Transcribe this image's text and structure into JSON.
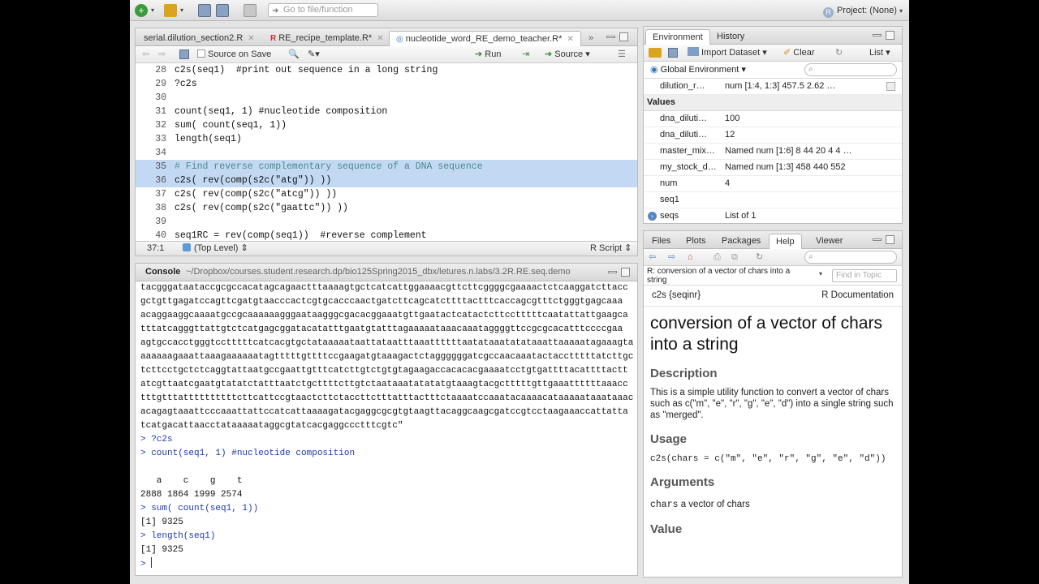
{
  "toolbar": {
    "goto_placeholder": "Go to file/function",
    "project_label": "Project: (None)"
  },
  "editor": {
    "tabs": [
      {
        "label": "serial.dilution_section2.R",
        "modified": false
      },
      {
        "label": "RE_recipe_template.R*",
        "modified": true
      },
      {
        "label": "nucleotide_word_RE_demo_teacher.R*",
        "modified": true
      }
    ],
    "source_on_save": "Source on Save",
    "run_label": "Run",
    "source_label": "Source",
    "cursor_pos": "37:1",
    "scope": "(Top Level)",
    "file_type": "R Script",
    "lines": [
      {
        "n": "28",
        "code": "c2s(seq1)  #print out sequence in a long string"
      },
      {
        "n": "29",
        "code": "?c2s"
      },
      {
        "n": "30",
        "code": ""
      },
      {
        "n": "31",
        "code": "count(seq1, 1) #nucleotide composition"
      },
      {
        "n": "32",
        "code": "sum( count(seq1, 1))"
      },
      {
        "n": "33",
        "code": "length(seq1)"
      },
      {
        "n": "34",
        "code": ""
      },
      {
        "n": "35",
        "code": "# Find reverse complementary sequence of a DNA sequence"
      },
      {
        "n": "36",
        "code": "c2s( rev(comp(s2c(\"atg\")) ))"
      },
      {
        "n": "37",
        "code": "c2s( rev(comp(s2c(\"atcg\")) ))"
      },
      {
        "n": "38",
        "code": "c2s( rev(comp(s2c(\"gaattc\")) ))"
      },
      {
        "n": "39",
        "code": ""
      },
      {
        "n": "40",
        "code": "seq1RC = rev(comp(seq1))  #reverse complement"
      }
    ]
  },
  "console": {
    "title": "Console",
    "path": "~/Dropbox/courses.student.research.dp/bio125Spring2015_dbx/letures.n.labs/3.2R.RE.seq.demo",
    "sequence_lines": [
      "tacgggataataccgcgccacatagcagaactttaaaagtgctcatcattggaaaacgttcttcggggcgaaaactctcaaggatcttacc",
      "gctgttgagatccagttcgatgtaacccactcgtgcacccaactgatcttcagcatcttttactttcaccagcgtttctgggtgagcaaa",
      "acaggaaggcaaaatgccgcaaaaaagggaataagggcgacacggaaatgttgaatactcatactcttcctttttcaatattattgaagca",
      "tttatcagggttattgtctcatgagcggatacatatttgaatgtatttagaaaaataaacaaataggggttccgcgcacatttccccgaa",
      "agtgccacctgggtcctttttcatcacgtgctataaaaataattataatttaaattttttaatataaatatataaattaaaaatagaaagta",
      "aaaaaagaaattaaagaaaaaatagtttttgttttccgaagatgtaaagactctaggggggatcgccaacaaatactacctttttatcttgc",
      "tcttcctgctctcaggtattaatgccgaattgtttcatcttgtctgtgtagaagaccacacacgaaaatcctgtgattttacattttactt",
      "atcgttaatcgaatgtatatctatttaatctgcttttcttgtctaataaatatatatgtaaagtacgctttttgttgaaattttttaaacc",
      "tttgtttattttttttttcttcattccgtaactcttctaccttctttatttactttctaaaatccaaatacaaaacataaaaataaataaac",
      "acagagtaaattcccaaattattccatcattaaaagatacgaggcgcgtgtaagttacaggcaagcgatccgtcctaagaaaccattatta",
      "tcatgacattaacctataaaaataggcgtatcacgaggccctttcgtc\""
    ],
    "entries": [
      {
        "kind": "cmd",
        "text": "> ?c2s"
      },
      {
        "kind": "cmd",
        "text": "> count(seq1, 1) #nucleotide composition"
      },
      {
        "kind": "out",
        "text": ""
      },
      {
        "kind": "out",
        "text": "   a    c    g    t "
      },
      {
        "kind": "out",
        "text": "2888 1864 1999 2574 "
      },
      {
        "kind": "cmd",
        "text": "> sum( count(seq1, 1))"
      },
      {
        "kind": "out",
        "text": "[1] 9325"
      },
      {
        "kind": "cmd",
        "text": "> length(seq1)"
      },
      {
        "kind": "out",
        "text": "[1] 9325"
      },
      {
        "kind": "cmd",
        "text": "> "
      }
    ]
  },
  "environment": {
    "tabs": [
      "Environment",
      "History"
    ],
    "import_label": "Import Dataset",
    "clear_label": "Clear",
    "list_label": "List",
    "scope_label": "Global Environment",
    "data_row": {
      "name": "dilution_r…",
      "value": "num [1:4, 1:3] 457.5 2.62 …"
    },
    "values_header": "Values",
    "values": [
      {
        "name": "dna_diluti…",
        "value": "100"
      },
      {
        "name": "dna_diluti…",
        "value": "12"
      },
      {
        "name": "master_mix…",
        "value": "Named num [1:6] 8 44 20 4 4 …"
      },
      {
        "name": "my_stock_d…",
        "value": "Named num [1:3] 458 440 552"
      },
      {
        "name": "num",
        "value": "4"
      },
      {
        "name": "seq1",
        "value": ""
      },
      {
        "name": "seqs",
        "value": "List of 1"
      }
    ]
  },
  "help": {
    "tabs": [
      "Files",
      "Plots",
      "Packages",
      "Help",
      "Viewer"
    ],
    "topic": "R: conversion of a vector of chars into a string",
    "find_placeholder": "Find in Topic",
    "pkg": "c2s {seqinr}",
    "doc_label": "R Documentation",
    "title": "conversion of a vector of chars into a string",
    "description_h": "Description",
    "description": "This is a simple utility function to convert a vector of chars such as c(\"m\", \"e\", \"r\", \"g\", \"e\", \"d\") into a single string such as \"merged\".",
    "usage_h": "Usage",
    "usage": "c2s(chars = c(\"m\", \"e\", \"r\", \"g\", \"e\", \"d\"))",
    "arguments_h": "Arguments",
    "arg_name": "chars",
    "arg_desc": "a vector of chars",
    "value_h": "Value"
  }
}
